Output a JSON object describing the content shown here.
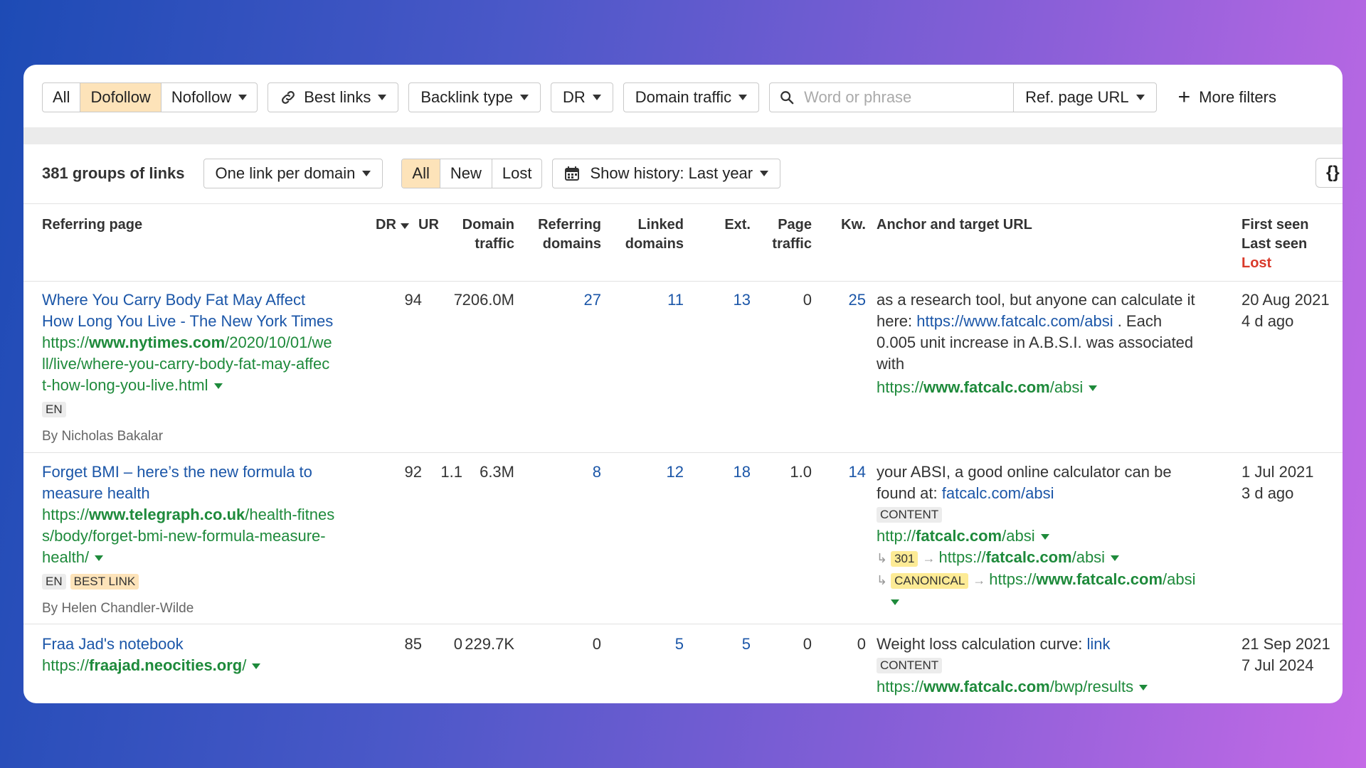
{
  "filters": {
    "segment": [
      "All",
      "Dofollow",
      "Nofollow"
    ],
    "best_links": "Best links",
    "backlink_type": "Backlink type",
    "dr": "DR",
    "domain_traffic": "Domain traffic",
    "search_placeholder": "Word or phrase",
    "ref_page_url": "Ref. page URL",
    "more_filters": "More filters"
  },
  "toolbar2": {
    "groups": "381 groups of links",
    "grouping": "One link per domain",
    "status": [
      "All",
      "New",
      "Lost"
    ],
    "history": "Show history: Last year",
    "corner": "{}"
  },
  "headers": {
    "referring_page": "Referring page",
    "dr": "DR",
    "ur": "UR",
    "domain_traffic": [
      "Domain",
      "traffic"
    ],
    "referring_domains": [
      "Referring",
      "domains"
    ],
    "linked_domains": [
      "Linked",
      "domains"
    ],
    "ext": "Ext.",
    "page_traffic": [
      "Page",
      "traffic"
    ],
    "kw": "Kw.",
    "anchor": "Anchor and target URL",
    "first_seen": "First seen",
    "last_seen": "Last seen",
    "lost": "Lost"
  },
  "rows": [
    {
      "title": [
        "Where You Carry Body Fat May Affect",
        "How Long You Live - The New York Times"
      ],
      "url": {
        "pre": "https://",
        "domain": "www.nytimes.com",
        "path": [
          "/2020/10/01/we",
          "ll/live/where-you-carry-body-fat-may-affec",
          "t-how-long-you-live.html"
        ]
      },
      "tags": [
        "EN"
      ],
      "author": "By Nicholas Bakalar",
      "dr": "94",
      "ur": "7",
      "domain_traffic": "206.0M",
      "ref_domains": "27",
      "linked_domains": "11",
      "ext": "13",
      "page_traffic": "0",
      "kw": "25",
      "anchor": {
        "line1": "as a research tool, but anyone can calculate it",
        "line2_pre": "here: ",
        "line2_link": "https://www.fatcalc.com/absi",
        "line2_post": " . Each",
        "line3": "0.005 unit increase in A.B.S.I. was associated",
        "line4": "with"
      },
      "target": {
        "pre": "https://",
        "domain": "www.fatcalc.com",
        "path": "/absi"
      },
      "first_seen": "20 Aug 2021",
      "last_seen": "4 d ago"
    },
    {
      "title": [
        "Forget BMI – here’s the new formula to",
        "measure health"
      ],
      "url": {
        "pre": "https://",
        "domain": "www.telegraph.co.uk",
        "path": [
          "/health-fitnes",
          "s/body/forget-bmi-new-formula-measure-",
          "health/"
        ]
      },
      "tags": [
        "EN",
        "BEST LINK"
      ],
      "author": "By Helen Chandler-Wilde",
      "dr": "92",
      "ur": "1.1",
      "domain_traffic": "6.3M",
      "ref_domains": "8",
      "linked_domains": "12",
      "ext": "18",
      "page_traffic": "1.0",
      "kw": "14",
      "anchor": {
        "line1": "your ABSI, a good online calculator can be",
        "line2_pre": "found at: ",
        "line2_link": "fatcalc.com/absi"
      },
      "anchor_tag": "CONTENT",
      "target": {
        "pre": "http://",
        "domain": "fatcalc.com",
        "path": "/absi"
      },
      "redirect1": {
        "code": "301",
        "pre": "https://",
        "domain": "fatcalc.com",
        "path": "/absi"
      },
      "redirect2": {
        "code": "CANONICAL",
        "pre": "https://",
        "domain": "www.fatcalc.com",
        "path": "/absi"
      },
      "first_seen": "1 Jul 2021",
      "last_seen": "3 d ago"
    },
    {
      "title": [
        "Fraa Jad's notebook"
      ],
      "url": {
        "pre": "https://",
        "domain": "fraajad.neocities.org",
        "path": [
          "/"
        ]
      },
      "dr": "85",
      "ur": "0",
      "domain_traffic": "229.7K",
      "ref_domains": "0",
      "linked_domains": "5",
      "ext": "5",
      "page_traffic": "0",
      "kw": "0",
      "anchor": {
        "line1_pre": "Weight loss calculation curve: ",
        "line1_link": "link"
      },
      "anchor_tag": "CONTENT",
      "target": {
        "pre": "https://",
        "domain": "www.fatcalc.com",
        "path": "/bwp/results"
      },
      "first_seen": "21 Sep 2021",
      "last_seen": "7 Jul 2024"
    }
  ],
  "colors": {
    "link_blue": "#1b56a8",
    "url_green": "#1e8a3b",
    "lost_red": "#d93a2b",
    "active_orange": "#fde3b9"
  }
}
